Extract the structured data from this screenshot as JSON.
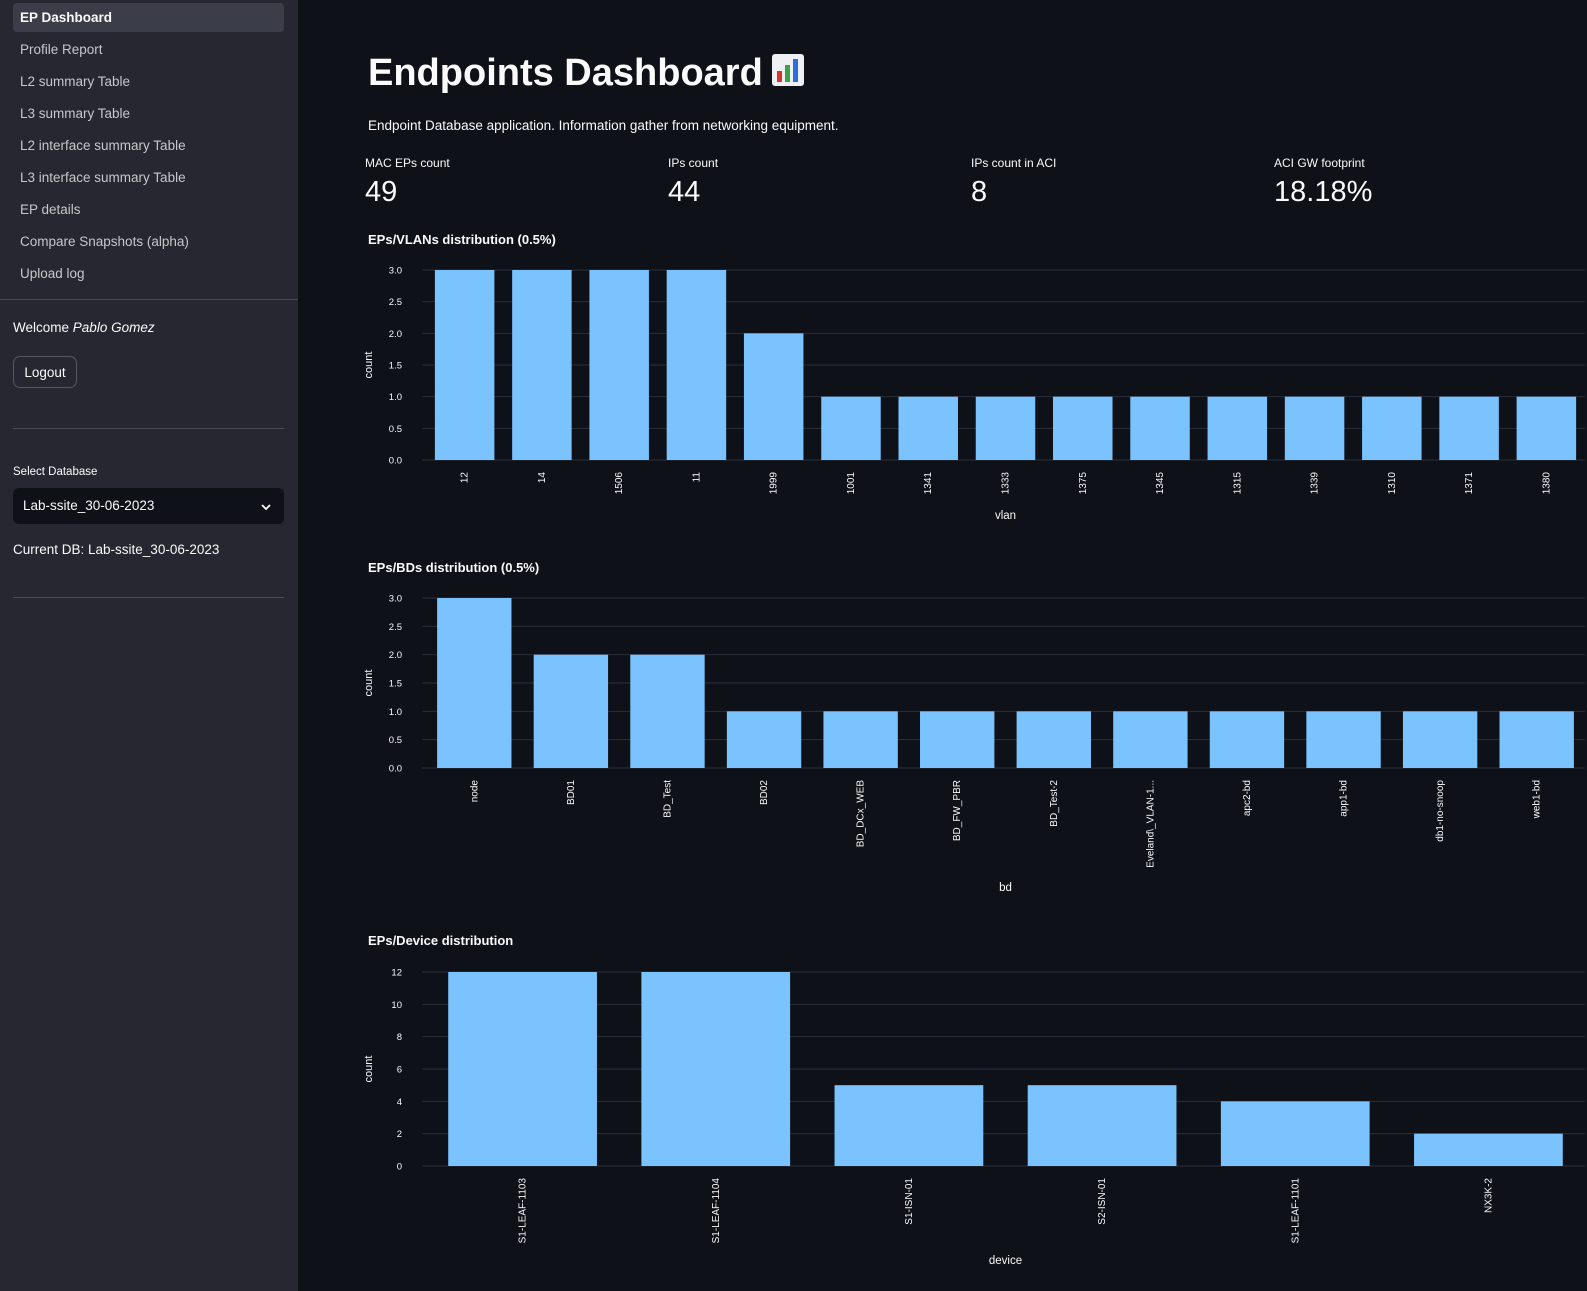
{
  "sidebar": {
    "nav": [
      {
        "label": "EP Dashboard",
        "active": true
      },
      {
        "label": "Profile Report"
      },
      {
        "label": "L2 summary Table"
      },
      {
        "label": "L3 summary Table"
      },
      {
        "label": "L2 interface summary Table"
      },
      {
        "label": "L3 interface summary Table"
      },
      {
        "label": "EP details"
      },
      {
        "label": "Compare Snapshots (alpha)"
      },
      {
        "label": "Upload log"
      }
    ],
    "welcome_prefix": "Welcome",
    "user_name": "Pablo Gomez",
    "logout_label": "Logout",
    "select_label": "Select Database",
    "select_value": "Lab-ssite_30-06-2023",
    "current_db": "Current DB: Lab-ssite_30-06-2023"
  },
  "main": {
    "title": "Endpoints Dashboard",
    "subtitle": "Endpoint Database application. Information gather from networking equipment.",
    "metrics": [
      {
        "label": "MAC EPs count",
        "value": "49"
      },
      {
        "label": "IPs count",
        "value": "44"
      },
      {
        "label": "IPs count in ACI",
        "value": "8"
      },
      {
        "label": "ACI GW footprint",
        "value": "18.18%"
      }
    ]
  },
  "colors": {
    "background": "#0e1117",
    "sidebar": "#262730",
    "bar": "#7ac3ff",
    "grid": "#2a2e38",
    "text": "#fafafa"
  },
  "chart_data": [
    {
      "type": "bar",
      "title": "EPs/VLANs distribution (0.5%)",
      "xlabel": "vlan",
      "ylabel": "count",
      "categories": [
        "12",
        "14",
        "1506",
        "11",
        "1999",
        "1001",
        "1341",
        "1333",
        "1375",
        "1345",
        "1315",
        "1339",
        "1310",
        "1371",
        "1380"
      ],
      "values": [
        3,
        3,
        3,
        3,
        2,
        1,
        1,
        1,
        1,
        1,
        1,
        1,
        1,
        1,
        1
      ],
      "ylim": [
        0,
        3
      ],
      "yticks": [
        "0.0",
        "0.5",
        "1.0",
        "1.5",
        "2.0",
        "2.5",
        "3.0"
      ],
      "grid": true
    },
    {
      "type": "bar",
      "title": "EPs/BDs distribution (0.5%)",
      "xlabel": "bd",
      "ylabel": "count",
      "categories": [
        "node",
        "BD01",
        "BD_Test",
        "BD02",
        "BD_DCx_WEB",
        "BD_FW_PBR",
        "BD_Test-2",
        "Eveland\\_VLAN-1...",
        "apc2-bd",
        "app1-bd",
        "db1-no-snoop",
        "web1-bd"
      ],
      "values": [
        3,
        2,
        2,
        1,
        1,
        1,
        1,
        1,
        1,
        1,
        1,
        1
      ],
      "ylim": [
        0,
        3
      ],
      "yticks": [
        "0.0",
        "0.5",
        "1.0",
        "1.5",
        "2.0",
        "2.5",
        "3.0"
      ],
      "grid": true
    },
    {
      "type": "bar",
      "title": "EPs/Device distribution",
      "xlabel": "device",
      "ylabel": "count",
      "categories": [
        "S1-LEAF-1103",
        "S1-LEAF-1104",
        "S1-ISN-01",
        "S2-ISN-01",
        "S1-LEAF-1101",
        "NX3K-2"
      ],
      "values": [
        12,
        12,
        5,
        5,
        4,
        2
      ],
      "ylim": [
        0,
        12
      ],
      "yticks": [
        "0",
        "2",
        "4",
        "6",
        "8",
        "10",
        "12"
      ],
      "grid": true
    }
  ]
}
